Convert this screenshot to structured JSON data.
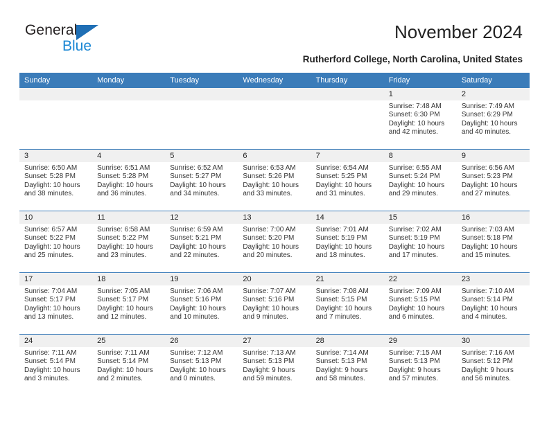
{
  "brand": {
    "name_part1": "General",
    "name_part2": "Blue",
    "accent_color": "#1b87d4",
    "triangle_color": "#1f6fb5"
  },
  "header": {
    "title": "November 2024",
    "subtitle": "Rutherford College, North Carolina, United States"
  },
  "calendar": {
    "header_bg": "#3b7cb9",
    "daynum_bg": "#f0f0f0",
    "weekdays": [
      "Sunday",
      "Monday",
      "Tuesday",
      "Wednesday",
      "Thursday",
      "Friday",
      "Saturday"
    ],
    "weeks": [
      [
        {
          "day": "",
          "empty": true
        },
        {
          "day": "",
          "empty": true
        },
        {
          "day": "",
          "empty": true
        },
        {
          "day": "",
          "empty": true
        },
        {
          "day": "",
          "empty": true
        },
        {
          "day": "1",
          "sunrise": "Sunrise: 7:48 AM",
          "sunset": "Sunset: 6:30 PM",
          "daylight1": "Daylight: 10 hours",
          "daylight2": "and 42 minutes."
        },
        {
          "day": "2",
          "sunrise": "Sunrise: 7:49 AM",
          "sunset": "Sunset: 6:29 PM",
          "daylight1": "Daylight: 10 hours",
          "daylight2": "and 40 minutes."
        }
      ],
      [
        {
          "day": "3",
          "sunrise": "Sunrise: 6:50 AM",
          "sunset": "Sunset: 5:28 PM",
          "daylight1": "Daylight: 10 hours",
          "daylight2": "and 38 minutes."
        },
        {
          "day": "4",
          "sunrise": "Sunrise: 6:51 AM",
          "sunset": "Sunset: 5:28 PM",
          "daylight1": "Daylight: 10 hours",
          "daylight2": "and 36 minutes."
        },
        {
          "day": "5",
          "sunrise": "Sunrise: 6:52 AM",
          "sunset": "Sunset: 5:27 PM",
          "daylight1": "Daylight: 10 hours",
          "daylight2": "and 34 minutes."
        },
        {
          "day": "6",
          "sunrise": "Sunrise: 6:53 AM",
          "sunset": "Sunset: 5:26 PM",
          "daylight1": "Daylight: 10 hours",
          "daylight2": "and 33 minutes."
        },
        {
          "day": "7",
          "sunrise": "Sunrise: 6:54 AM",
          "sunset": "Sunset: 5:25 PM",
          "daylight1": "Daylight: 10 hours",
          "daylight2": "and 31 minutes."
        },
        {
          "day": "8",
          "sunrise": "Sunrise: 6:55 AM",
          "sunset": "Sunset: 5:24 PM",
          "daylight1": "Daylight: 10 hours",
          "daylight2": "and 29 minutes."
        },
        {
          "day": "9",
          "sunrise": "Sunrise: 6:56 AM",
          "sunset": "Sunset: 5:23 PM",
          "daylight1": "Daylight: 10 hours",
          "daylight2": "and 27 minutes."
        }
      ],
      [
        {
          "day": "10",
          "sunrise": "Sunrise: 6:57 AM",
          "sunset": "Sunset: 5:22 PM",
          "daylight1": "Daylight: 10 hours",
          "daylight2": "and 25 minutes."
        },
        {
          "day": "11",
          "sunrise": "Sunrise: 6:58 AM",
          "sunset": "Sunset: 5:22 PM",
          "daylight1": "Daylight: 10 hours",
          "daylight2": "and 23 minutes."
        },
        {
          "day": "12",
          "sunrise": "Sunrise: 6:59 AM",
          "sunset": "Sunset: 5:21 PM",
          "daylight1": "Daylight: 10 hours",
          "daylight2": "and 22 minutes."
        },
        {
          "day": "13",
          "sunrise": "Sunrise: 7:00 AM",
          "sunset": "Sunset: 5:20 PM",
          "daylight1": "Daylight: 10 hours",
          "daylight2": "and 20 minutes."
        },
        {
          "day": "14",
          "sunrise": "Sunrise: 7:01 AM",
          "sunset": "Sunset: 5:19 PM",
          "daylight1": "Daylight: 10 hours",
          "daylight2": "and 18 minutes."
        },
        {
          "day": "15",
          "sunrise": "Sunrise: 7:02 AM",
          "sunset": "Sunset: 5:19 PM",
          "daylight1": "Daylight: 10 hours",
          "daylight2": "and 17 minutes."
        },
        {
          "day": "16",
          "sunrise": "Sunrise: 7:03 AM",
          "sunset": "Sunset: 5:18 PM",
          "daylight1": "Daylight: 10 hours",
          "daylight2": "and 15 minutes."
        }
      ],
      [
        {
          "day": "17",
          "sunrise": "Sunrise: 7:04 AM",
          "sunset": "Sunset: 5:17 PM",
          "daylight1": "Daylight: 10 hours",
          "daylight2": "and 13 minutes."
        },
        {
          "day": "18",
          "sunrise": "Sunrise: 7:05 AM",
          "sunset": "Sunset: 5:17 PM",
          "daylight1": "Daylight: 10 hours",
          "daylight2": "and 12 minutes."
        },
        {
          "day": "19",
          "sunrise": "Sunrise: 7:06 AM",
          "sunset": "Sunset: 5:16 PM",
          "daylight1": "Daylight: 10 hours",
          "daylight2": "and 10 minutes."
        },
        {
          "day": "20",
          "sunrise": "Sunrise: 7:07 AM",
          "sunset": "Sunset: 5:16 PM",
          "daylight1": "Daylight: 10 hours",
          "daylight2": "and 9 minutes."
        },
        {
          "day": "21",
          "sunrise": "Sunrise: 7:08 AM",
          "sunset": "Sunset: 5:15 PM",
          "daylight1": "Daylight: 10 hours",
          "daylight2": "and 7 minutes."
        },
        {
          "day": "22",
          "sunrise": "Sunrise: 7:09 AM",
          "sunset": "Sunset: 5:15 PM",
          "daylight1": "Daylight: 10 hours",
          "daylight2": "and 6 minutes."
        },
        {
          "day": "23",
          "sunrise": "Sunrise: 7:10 AM",
          "sunset": "Sunset: 5:14 PM",
          "daylight1": "Daylight: 10 hours",
          "daylight2": "and 4 minutes."
        }
      ],
      [
        {
          "day": "24",
          "sunrise": "Sunrise: 7:11 AM",
          "sunset": "Sunset: 5:14 PM",
          "daylight1": "Daylight: 10 hours",
          "daylight2": "and 3 minutes."
        },
        {
          "day": "25",
          "sunrise": "Sunrise: 7:11 AM",
          "sunset": "Sunset: 5:14 PM",
          "daylight1": "Daylight: 10 hours",
          "daylight2": "and 2 minutes."
        },
        {
          "day": "26",
          "sunrise": "Sunrise: 7:12 AM",
          "sunset": "Sunset: 5:13 PM",
          "daylight1": "Daylight: 10 hours",
          "daylight2": "and 0 minutes."
        },
        {
          "day": "27",
          "sunrise": "Sunrise: 7:13 AM",
          "sunset": "Sunset: 5:13 PM",
          "daylight1": "Daylight: 9 hours",
          "daylight2": "and 59 minutes."
        },
        {
          "day": "28",
          "sunrise": "Sunrise: 7:14 AM",
          "sunset": "Sunset: 5:13 PM",
          "daylight1": "Daylight: 9 hours",
          "daylight2": "and 58 minutes."
        },
        {
          "day": "29",
          "sunrise": "Sunrise: 7:15 AM",
          "sunset": "Sunset: 5:13 PM",
          "daylight1": "Daylight: 9 hours",
          "daylight2": "and 57 minutes."
        },
        {
          "day": "30",
          "sunrise": "Sunrise: 7:16 AM",
          "sunset": "Sunset: 5:12 PM",
          "daylight1": "Daylight: 9 hours",
          "daylight2": "and 56 minutes."
        }
      ]
    ]
  }
}
